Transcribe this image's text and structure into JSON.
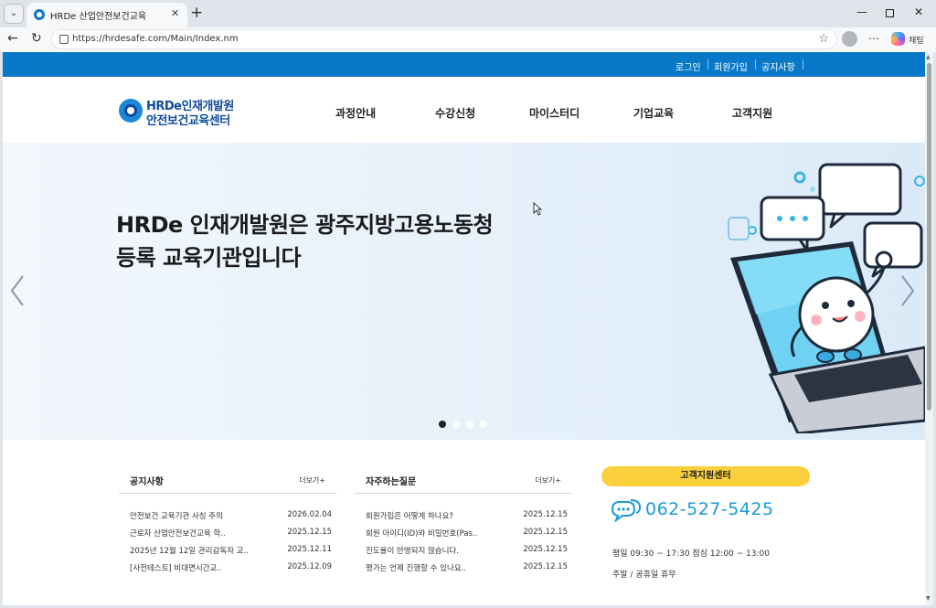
{
  "browser": {
    "tab_title": "HRDe 산업안전보건교육",
    "url": "https://hrdesafe.com/Main/Index.nm",
    "copilot_label": "채팅",
    "icons": {
      "tab_menu": "chevron-down-icon",
      "close_tab": "close-icon",
      "new_tab": "plus-icon",
      "back": "back-arrow-icon",
      "refresh": "refresh-icon",
      "favorite": "star-icon",
      "profile": "profile-icon",
      "more": "more-icon",
      "copilot": "copilot-icon"
    }
  },
  "site": {
    "top_links": [
      "로그인",
      "회원가입",
      "공지사항"
    ],
    "logo": {
      "line1": "HRDe인재개발원",
      "line2": "안전보건교육센터"
    },
    "nav": [
      "과정안내",
      "수강신청",
      "마이스터디",
      "기업교육",
      "고객지원"
    ],
    "hero": {
      "line1": "HRDe 인재개발원은 광주지방고용노동청",
      "line2": "등록 교육기관입니다",
      "slide_count": 4,
      "active_slide": 1
    },
    "notice": {
      "title": "공지사항",
      "more": "더보기+",
      "rows": [
        {
          "title": "안전보건 교육기관 사칭 주의",
          "date": "2026.02.04"
        },
        {
          "title": "근로자 산업안전보건교육 학..",
          "date": "2025.12.15"
        },
        {
          "title": "2025년 12월 12일 관리감독자 교..",
          "date": "2025.12.11"
        },
        {
          "title": "[사전테스트] 비대면시간교..",
          "date": "2025.12.09"
        }
      ]
    },
    "faq": {
      "title": "자주하는질문",
      "more": "더보기+",
      "rows": [
        {
          "title": "회원가입은 어떻게 하나요?",
          "date": "2025.12.15"
        },
        {
          "title": "회원 아이디(ID)와 비밀번호(Pas..",
          "date": "2025.12.15"
        },
        {
          "title": "진도율이 반영되지 않습니다.",
          "date": "2025.12.15"
        },
        {
          "title": "평가는 언제 진행할 수 있나요..",
          "date": "2025.12.15"
        }
      ]
    },
    "support": {
      "title": "고객지원센터",
      "phone": "062-527-5425",
      "hours": "평일 09:30 ~ 17:30 점심 12:00 ~ 13:00",
      "holiday": "주말 / 공휴일 휴무"
    },
    "colors": {
      "brand_blue": "#0879c9",
      "logo_navy": "#0e4c9c",
      "support_yellow": "#fcd03d",
      "phone_blue": "#1a9ad9"
    }
  }
}
